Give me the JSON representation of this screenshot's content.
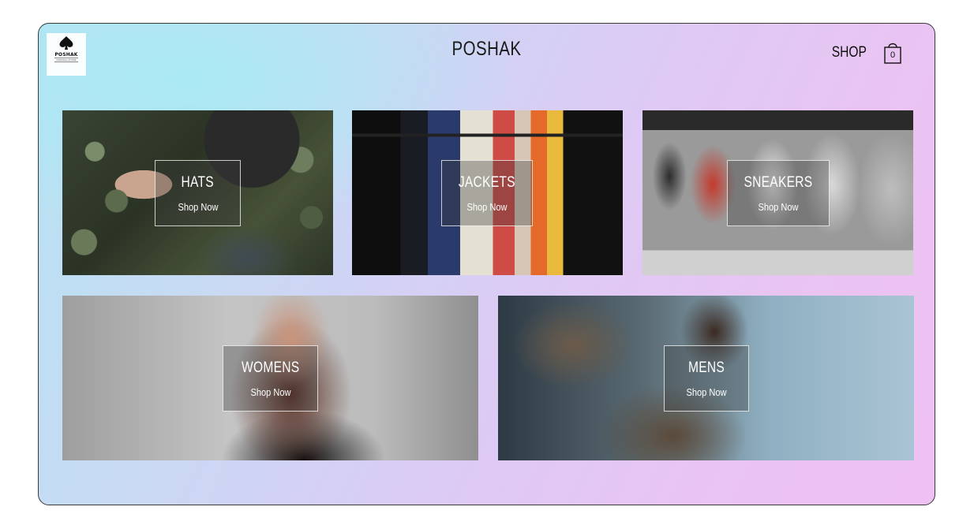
{
  "brand": {
    "logo_word": "POSHAK",
    "logo_tagline": "ORIGINAL ATTIRE",
    "title": "POSHAK"
  },
  "nav": {
    "shop_label": "SHOP",
    "cart_count": "0"
  },
  "categories": [
    {
      "title": "HATS",
      "cta": "Shop Now"
    },
    {
      "title": "JACKETS",
      "cta": "Shop Now"
    },
    {
      "title": "SNEAKERS",
      "cta": "Shop Now"
    },
    {
      "title": "WOMENS",
      "cta": "Shop Now"
    },
    {
      "title": "MENS",
      "cta": "Shop Now"
    }
  ],
  "colors": {
    "gradient_start": "#b6e3f2",
    "gradient_end": "#efc0f3",
    "frame_border": "#3a3a3a",
    "overlay_text": "#ffffff"
  }
}
